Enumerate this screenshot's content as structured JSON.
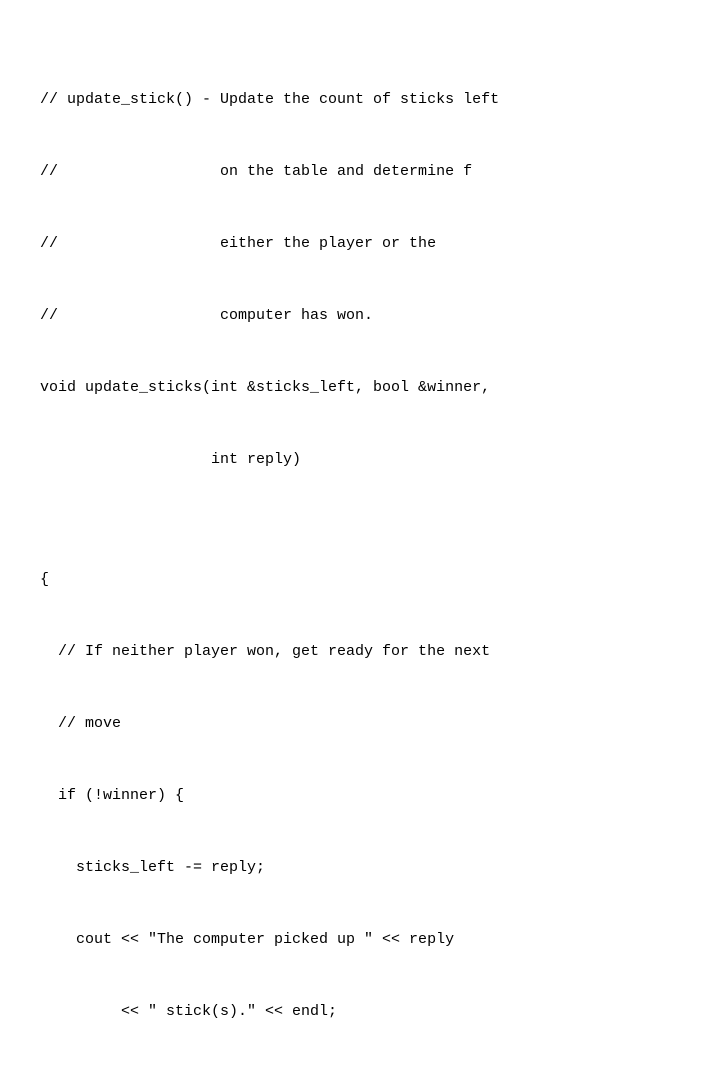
{
  "code": {
    "lines": [
      "// update_stick() - Update the count of sticks left",
      "//                  on the table and determine f",
      "//                  either the player or the",
      "//                  computer has won.",
      "void update_sticks(int &sticks_left, bool &winner,",
      "                   int reply)",
      "",
      "{",
      "  // If neither player won, get ready for the next",
      "  // move",
      "  if (!winner) {",
      "    sticks_left -= reply;",
      "    cout << \"The computer picked up \" << reply",
      "         << \" stick(s).\" << endl;"
    ]
  }
}
